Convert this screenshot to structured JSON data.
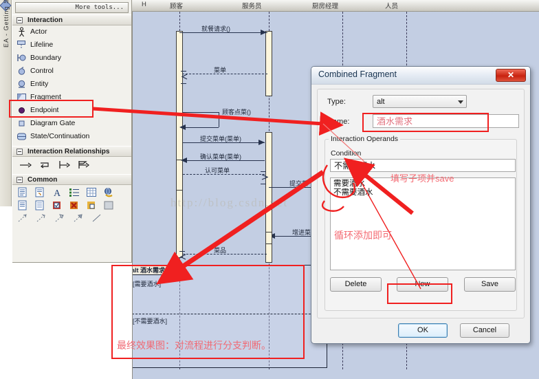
{
  "app": {
    "vertical_tab": "EA - Getting Started"
  },
  "toolbox": {
    "more_tools": "More tools...",
    "sections": [
      {
        "title": "Interaction",
        "items": [
          {
            "label": "Actor",
            "icon": "actor-icon"
          },
          {
            "label": "Lifeline",
            "icon": "lifeline-icon"
          },
          {
            "label": "Boundary",
            "icon": "boundary-icon"
          },
          {
            "label": "Control",
            "icon": "control-icon"
          },
          {
            "label": "Entity",
            "icon": "entity-icon"
          },
          {
            "label": "Fragment",
            "icon": "fragment-icon"
          },
          {
            "label": "Endpoint",
            "icon": "endpoint-icon"
          },
          {
            "label": "Diagram Gate",
            "icon": "diagram-gate-icon"
          },
          {
            "label": "State/Continuation",
            "icon": "state-continuation-icon"
          }
        ]
      },
      {
        "title": "Interaction Relationships",
        "icons": [
          "message-arrow-icon",
          "self-message-icon",
          "gate-message-icon",
          "flag-message-icon"
        ]
      },
      {
        "title": "Common",
        "icons_row1": [
          "note-icon",
          "note-link-icon",
          "text-icon",
          "list-icon",
          "table-icon",
          "web-icon"
        ],
        "icons_row2": [
          "document-icon",
          "document-plain-icon",
          "checkbox-icon",
          "cancel-doc-icon",
          "idea-doc-icon",
          "image-icon"
        ],
        "icons_row3": [
          "trace-icon",
          "trace2-icon",
          "trace3-icon",
          "trace4-icon",
          "connector-icon"
        ]
      }
    ]
  },
  "diagram": {
    "lifeline_headers": [
      "H",
      "顾客",
      "服务员",
      "厨房经理",
      "人员"
    ],
    "messages": [
      {
        "label": "就餐请求()"
      },
      {
        "label": "菜单"
      },
      {
        "label": "顾客点菜()"
      },
      {
        "label": "提交菜单(菜单)"
      },
      {
        "label": "确认菜单(菜单)"
      },
      {
        "label": "认可菜单"
      },
      {
        "label": "提交菜"
      },
      {
        "label": "增进菜"
      },
      {
        "label": "菜品"
      }
    ],
    "watermark": "http://blog.csdn.net",
    "result_fragment": {
      "tag": "alt 酒水需求",
      "guard_top": "[需要酒水]",
      "guard_bottom": "[不需要酒水]"
    }
  },
  "dialog": {
    "title": "Combined Fragment",
    "close_glyph": "✕",
    "type_label": "Type:",
    "type_value": "alt",
    "name_label": "Name:",
    "name_value": "酒水需求",
    "operands_group": "Interaction Operands",
    "condition_label": "Condition",
    "condition_value": "不需要酒水",
    "operand_list": [
      "需要酒水",
      "不需要酒水"
    ],
    "buttons": {
      "delete": "Delete",
      "new": "New",
      "save": "Save",
      "ok": "OK",
      "cancel": "Cancel"
    }
  },
  "annotations": {
    "fill_and_save": "填写子项并save",
    "loop_add": "循环添加即可",
    "final_effect": "最终效果图：对流程进行分支判断。",
    "accent_color": "#f02020",
    "text_color": "#f46a72"
  }
}
